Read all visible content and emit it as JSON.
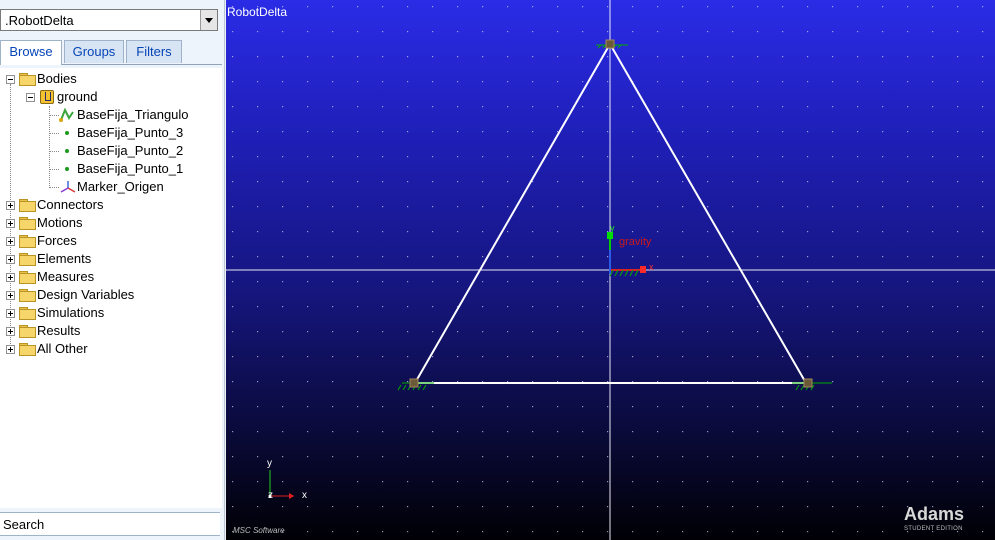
{
  "model_selector": {
    "value": ".RobotDelta"
  },
  "tabs": [
    {
      "label": "Browse",
      "active": true
    },
    {
      "label": "Groups",
      "active": false
    },
    {
      "label": "Filters",
      "active": false
    }
  ],
  "tree": {
    "bodies": "Bodies",
    "ground": "ground",
    "children": [
      "BaseFija_Triangulo",
      "BaseFija_Punto_3",
      "BaseFija_Punto_2",
      "BaseFija_Punto_1",
      "Marker_Origen"
    ],
    "categories": [
      "Connectors",
      "Motions",
      "Forces",
      "Elements",
      "Measures",
      "Design Variables",
      "Simulations",
      "Results",
      "All Other"
    ]
  },
  "search": {
    "label": "Search"
  },
  "viewport": {
    "title": "RobotDelta",
    "gravity_label": "gravity",
    "axis_y": "y",
    "axis_x": "x",
    "triad_y": "y",
    "triad_z": "z",
    "triad_x": "x",
    "msc_logo": "MSC Software",
    "brand": "Adams",
    "brand_sub": "STUDENT EDITION"
  },
  "colors": {
    "accent_tab": "#0645b8",
    "gravity": "#cc1a1a",
    "marker_green": "#00cc00",
    "geometry": "#ffffff"
  }
}
